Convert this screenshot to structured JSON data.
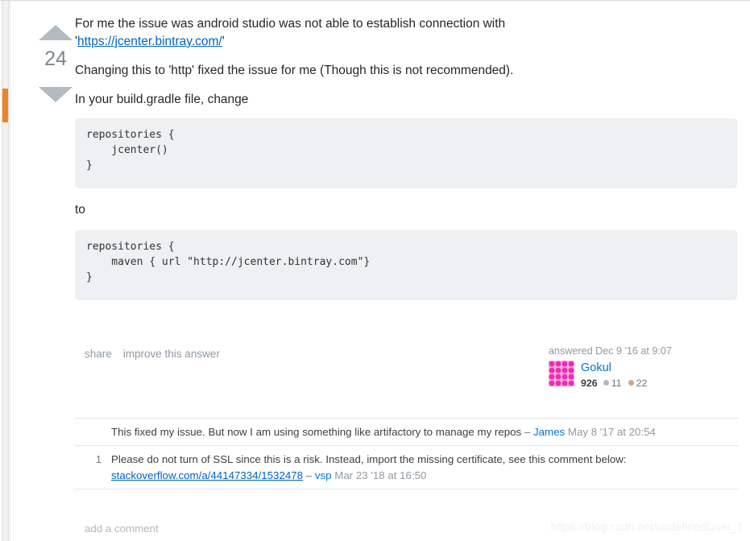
{
  "vote": {
    "up_icon": "arrow-up-icon",
    "count": "24",
    "down_icon": "arrow-down-icon"
  },
  "post": {
    "paragraph_1_before_link": "For me the issue was android studio was not able to establish connection with",
    "paragraph_1_quote_open": "'",
    "paragraph_1_link": "https://jcenter.bintray.com/",
    "paragraph_1_quote_close": "'",
    "paragraph_2": "Changing this to 'http' fixed the issue for me (Though this is not recommended).",
    "paragraph_3": "In your build.gradle file, change",
    "code_block_1": "repositories {\n    jcenter()\n}",
    "connector": "to",
    "code_block_2": "repositories {\n    maven { url \"http://jcenter.bintray.com\"}\n}"
  },
  "postmenu": {
    "share_label": "share",
    "improve_label": "improve this answer"
  },
  "usercard": {
    "action_time": "answered Dec 9 '16 at 9:07",
    "avatar_icon": "identicon-avatar",
    "username": "Gokul",
    "reputation": "926",
    "silver_badge_count": "11",
    "bronze_badge_count": "22",
    "silver_color": "#b4b8bc",
    "bronze_color": "#d1a684"
  },
  "comments": [
    {
      "score": "",
      "text": "This fixed my issue. But now I am using something like artifactory to manage my repos",
      "link_text": "",
      "dash": "–",
      "user": "James",
      "date": "May 8 '17 at 20:54"
    },
    {
      "score": "1",
      "text": "Please do not turn of SSL since this is a risk. Instead, import the missing certificate, see this comment below:",
      "link_text": "stackoverflow.com/a/44147334/1532478",
      "dash": "–",
      "user": "vsp",
      "date": "Mar 23 '18 at 16:50"
    }
  ],
  "footer": {
    "add_comment_label": "add a comment"
  },
  "watermark": {
    "text": "https://blog.csdn.net/undefinedUser_1"
  },
  "colors": {
    "link": "#0077cc",
    "link_visited": "#0063bf",
    "code_background": "#eff0f1",
    "scrollbar_thumb": "#ef8427",
    "vote_arrow": "#b3bac1"
  }
}
